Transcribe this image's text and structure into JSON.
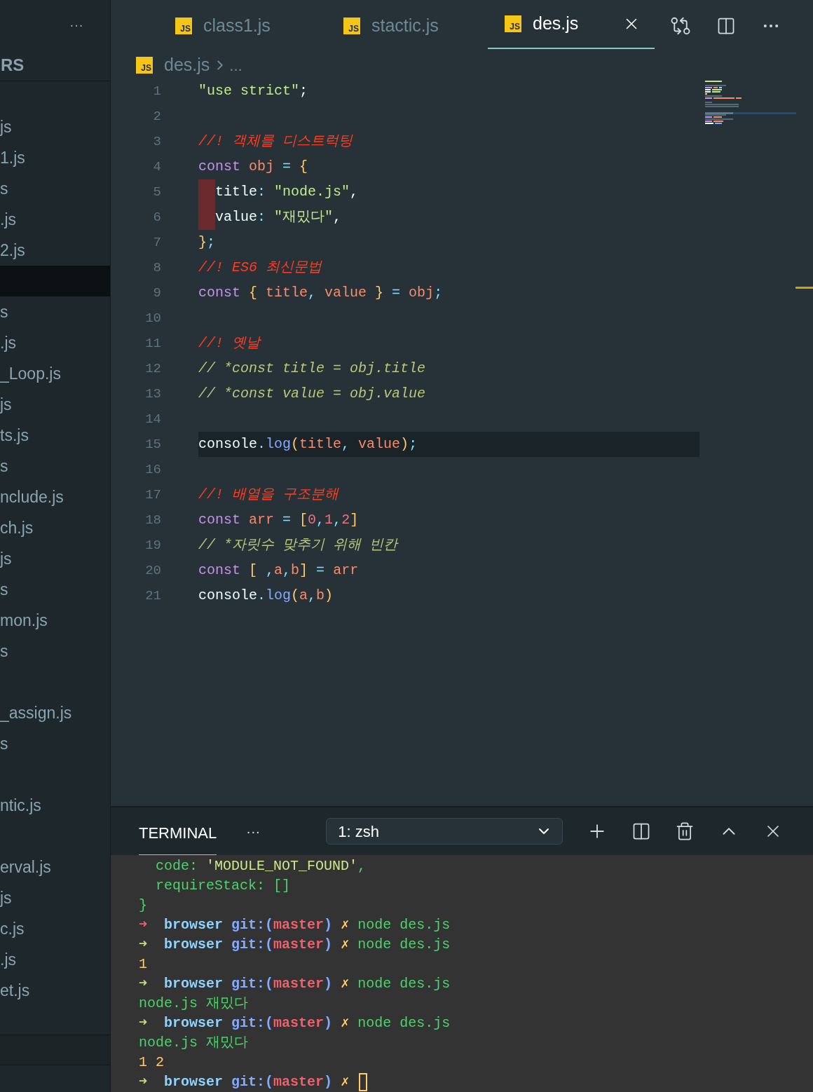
{
  "sidebar": {
    "more": "···",
    "header": "RS",
    "items": [
      {
        "label": "js",
        "selected": false
      },
      {
        "label": "1.js",
        "selected": false
      },
      {
        "label": "s",
        "selected": false
      },
      {
        "label": ".js",
        "selected": false
      },
      {
        "label": "2.js",
        "selected": false
      },
      {
        "selected": true
      },
      {
        "label": "s",
        "selected": false
      },
      {
        "label": ".js",
        "selected": false
      },
      {
        "label": "_Loop.js",
        "selected": false
      },
      {
        "label": "js",
        "selected": false
      },
      {
        "label": "ts.js",
        "selected": false
      },
      {
        "label": "s",
        "selected": false
      },
      {
        "label": "nclude.js",
        "selected": false
      },
      {
        "label": "ch.js",
        "selected": false
      },
      {
        "label": "js",
        "selected": false
      },
      {
        "label": "s",
        "selected": false
      },
      {
        "label": "mon.js",
        "selected": false
      },
      {
        "label": "s",
        "selected": false
      },
      {
        "selected": false
      },
      {
        "label": "_assign.js",
        "selected": false
      },
      {
        "label": "s",
        "selected": false
      },
      {
        "selected": false
      },
      {
        "label": "ntic.js",
        "selected": false
      },
      {
        "selected": false
      },
      {
        "label": "erval.js",
        "selected": false
      },
      {
        "label": "js",
        "selected": false
      },
      {
        "label": "c.js",
        "selected": false
      },
      {
        "label": ".js",
        "selected": false
      },
      {
        "label": "et.js",
        "selected": false
      }
    ]
  },
  "tabs": [
    {
      "badge": "JS",
      "label": "class1.js",
      "selected": false
    },
    {
      "badge": "JS",
      "label": "stactic.js",
      "selected": false
    },
    {
      "badge": "JS",
      "label": "des.js",
      "selected": true
    }
  ],
  "breadcrumb": {
    "badge": "JS",
    "file": "des.js",
    "rest": "..."
  },
  "code_lines": [
    {
      "number": "1",
      "tokens": [
        {
          "t": "\"use strict\"",
          "kind": "str"
        },
        {
          "t": ";",
          "kind": "plain"
        }
      ]
    },
    {
      "number": "2"
    },
    {
      "number": "3",
      "tokens": [
        {
          "t": "//! 객체를 디스트럭팅",
          "kind": "alert"
        }
      ]
    },
    {
      "number": "4",
      "tokens": [
        {
          "t": "const ",
          "kind": "kw"
        },
        {
          "t": "obj ",
          "kind": "var"
        },
        {
          "t": "= ",
          "kind": "op"
        },
        {
          "t": "{",
          "kind": "brace"
        }
      ]
    },
    {
      "number": "5",
      "indent_error": true,
      "tokens": [
        {
          "t": "title",
          "kind": "plain"
        },
        {
          "t": ": ",
          "kind": "op"
        },
        {
          "t": "\"node.js\"",
          "kind": "str"
        },
        {
          "t": ",",
          "kind": "plain"
        }
      ]
    },
    {
      "number": "6",
      "indent_error": true,
      "tokens": [
        {
          "t": "value",
          "kind": "plain"
        },
        {
          "t": ": ",
          "kind": "op"
        },
        {
          "t": "\"재밌다\"",
          "kind": "str"
        },
        {
          "t": ",",
          "kind": "plain"
        }
      ]
    },
    {
      "number": "7",
      "tokens": [
        {
          "t": "}",
          "kind": "brace"
        },
        {
          "t": ";",
          "kind": "op"
        }
      ]
    },
    {
      "number": "8",
      "tokens": [
        {
          "t": "//! ES6 최신문법",
          "kind": "alert"
        }
      ]
    },
    {
      "number": "9",
      "tokens": [
        {
          "t": "const ",
          "kind": "kw"
        },
        {
          "t": "{ ",
          "kind": "brace"
        },
        {
          "t": "title",
          "kind": "var"
        },
        {
          "t": ", ",
          "kind": "op"
        },
        {
          "t": "value ",
          "kind": "var"
        },
        {
          "t": "} ",
          "kind": "brace"
        },
        {
          "t": "= ",
          "kind": "op"
        },
        {
          "t": "obj",
          "kind": "var"
        },
        {
          "t": ";",
          "kind": "op"
        }
      ]
    },
    {
      "number": "10"
    },
    {
      "number": "11",
      "tokens": [
        {
          "t": "//! 옛날",
          "kind": "alert"
        }
      ]
    },
    {
      "number": "12",
      "tokens": [
        {
          "t": "// *const title = obj.title",
          "kind": "note"
        }
      ]
    },
    {
      "number": "13",
      "tokens": [
        {
          "t": "// *const value = obj.value",
          "kind": "note"
        }
      ]
    },
    {
      "number": "14"
    },
    {
      "number": "15",
      "current": true,
      "tokens": [
        {
          "t": "console",
          "kind": "plain"
        },
        {
          "t": ".",
          "kind": "op"
        },
        {
          "t": "log",
          "kind": "func"
        },
        {
          "t": "(",
          "kind": "brace"
        },
        {
          "t": "title",
          "kind": "var"
        },
        {
          "t": ", ",
          "kind": "op"
        },
        {
          "t": "value",
          "kind": "var"
        },
        {
          "t": ")",
          "kind": "brace"
        },
        {
          "t": ";",
          "kind": "op"
        }
      ]
    },
    {
      "number": "16"
    },
    {
      "number": "17",
      "tokens": [
        {
          "t": "//! 배열을 구조분해",
          "kind": "alert"
        }
      ]
    },
    {
      "number": "18",
      "tokens": [
        {
          "t": "const ",
          "kind": "kw"
        },
        {
          "t": "arr ",
          "kind": "var"
        },
        {
          "t": "= ",
          "kind": "op"
        },
        {
          "t": "[",
          "kind": "brace"
        },
        {
          "t": "0",
          "kind": "num"
        },
        {
          "t": ",",
          "kind": "op"
        },
        {
          "t": "1",
          "kind": "num"
        },
        {
          "t": ",",
          "kind": "op"
        },
        {
          "t": "2",
          "kind": "num"
        },
        {
          "t": "]",
          "kind": "brace"
        }
      ]
    },
    {
      "number": "19",
      "tokens": [
        {
          "t": "// *자릿수 맞추기 위해 빈칸",
          "kind": "note"
        }
      ]
    },
    {
      "number": "20",
      "tokens": [
        {
          "t": "const ",
          "kind": "kw"
        },
        {
          "t": "[ ",
          "kind": "brace"
        },
        {
          "t": ",",
          "kind": "op"
        },
        {
          "t": "a",
          "kind": "var"
        },
        {
          "t": ",",
          "kind": "op"
        },
        {
          "t": "b",
          "kind": "var"
        },
        {
          "t": "] ",
          "kind": "brace"
        },
        {
          "t": "= ",
          "kind": "op"
        },
        {
          "t": "arr",
          "kind": "var"
        }
      ]
    },
    {
      "number": "21",
      "tokens": [
        {
          "t": "console",
          "kind": "plain"
        },
        {
          "t": ".",
          "kind": "op"
        },
        {
          "t": "log",
          "kind": "func"
        },
        {
          "t": "(",
          "kind": "brace"
        },
        {
          "t": "a",
          "kind": "var"
        },
        {
          "t": ",",
          "kind": "op"
        },
        {
          "t": "b",
          "kind": "var"
        },
        {
          "t": ")",
          "kind": "brace"
        }
      ]
    }
  ],
  "panel": {
    "tab": {
      "label": "TERMINAL",
      "selected": true
    },
    "more": "···",
    "shell": "1: zsh"
  },
  "terminal_lines": [
    {
      "tokens": [
        {
          "t": "  code: ",
          "kind": "ok"
        },
        {
          "t": "'MODULE_NOT_FOUND'",
          "kind": "lit"
        },
        {
          "t": ",",
          "kind": "ok"
        }
      ]
    },
    {
      "tokens": [
        {
          "t": "  requireStack: []",
          "kind": "ok"
        }
      ]
    },
    {
      "tokens": [
        {
          "t": "}",
          "kind": "ok"
        }
      ]
    },
    {
      "tokens": [
        {
          "t": "➜ ",
          "kind": "arrow-fail"
        },
        {
          "t": " browser ",
          "kind": "dir"
        },
        {
          "t": "git:(",
          "kind": "git"
        },
        {
          "t": "master",
          "kind": "branch"
        },
        {
          "t": ") ",
          "kind": "git"
        },
        {
          "t": "✗ ",
          "kind": "dirty"
        },
        {
          "t": "node des.js",
          "kind": "ok"
        }
      ]
    },
    {
      "tokens": [
        {
          "t": "➜ ",
          "kind": "arrow-ok"
        },
        {
          "t": " browser ",
          "kind": "dir"
        },
        {
          "t": "git:(",
          "kind": "git"
        },
        {
          "t": "master",
          "kind": "branch"
        },
        {
          "t": ") ",
          "kind": "git"
        },
        {
          "t": "✗ ",
          "kind": "dirty"
        },
        {
          "t": "node des.js",
          "kind": "ok"
        }
      ]
    },
    {
      "tokens": [
        {
          "t": "1",
          "kind": "out"
        }
      ]
    },
    {
      "tokens": [
        {
          "t": "➜ ",
          "kind": "arrow-ok"
        },
        {
          "t": " browser ",
          "kind": "dir"
        },
        {
          "t": "git:(",
          "kind": "git"
        },
        {
          "t": "master",
          "kind": "branch"
        },
        {
          "t": ") ",
          "kind": "git"
        },
        {
          "t": "✗ ",
          "kind": "dirty"
        },
        {
          "t": "node des.js",
          "kind": "ok"
        }
      ]
    },
    {
      "tokens": [
        {
          "t": "node.js 재밌다",
          "kind": "ok"
        }
      ]
    },
    {
      "tokens": [
        {
          "t": "➜ ",
          "kind": "arrow-ok"
        },
        {
          "t": " browser ",
          "kind": "dir"
        },
        {
          "t": "git:(",
          "kind": "git"
        },
        {
          "t": "master",
          "kind": "branch"
        },
        {
          "t": ") ",
          "kind": "git"
        },
        {
          "t": "✗ ",
          "kind": "dirty"
        },
        {
          "t": "node des.js",
          "kind": "ok"
        }
      ]
    },
    {
      "tokens": [
        {
          "t": "node.js 재밌다",
          "kind": "ok"
        }
      ]
    },
    {
      "tokens": [
        {
          "t": "1 2",
          "kind": "out"
        }
      ]
    },
    {
      "cursor": true,
      "tokens": [
        {
          "t": "➜ ",
          "kind": "arrow-ok"
        },
        {
          "t": " browser ",
          "kind": "dir"
        },
        {
          "t": "git:(",
          "kind": "git"
        },
        {
          "t": "master",
          "kind": "branch"
        },
        {
          "t": ") ",
          "kind": "git"
        },
        {
          "t": "✗ ",
          "kind": "dirty"
        }
      ]
    }
  ]
}
